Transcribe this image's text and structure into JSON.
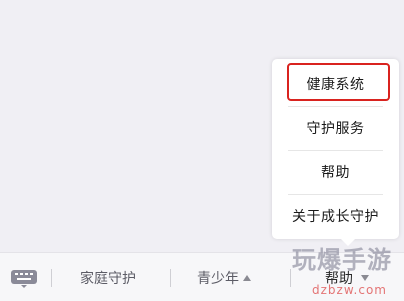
{
  "popup_menu": {
    "items": [
      {
        "label": "健康系统"
      },
      {
        "label": "守护服务"
      },
      {
        "label": "帮助"
      },
      {
        "label": "关于成长守护"
      }
    ]
  },
  "bottom_bar": {
    "items": [
      {
        "label": "家庭守护"
      },
      {
        "label": "青少年"
      },
      {
        "label": "帮助"
      }
    ]
  },
  "watermark": {
    "main": "玩爆手游",
    "sub": "dzbzw.com"
  },
  "colors": {
    "highlight": "#d9231f",
    "background": "#f0eff4"
  }
}
